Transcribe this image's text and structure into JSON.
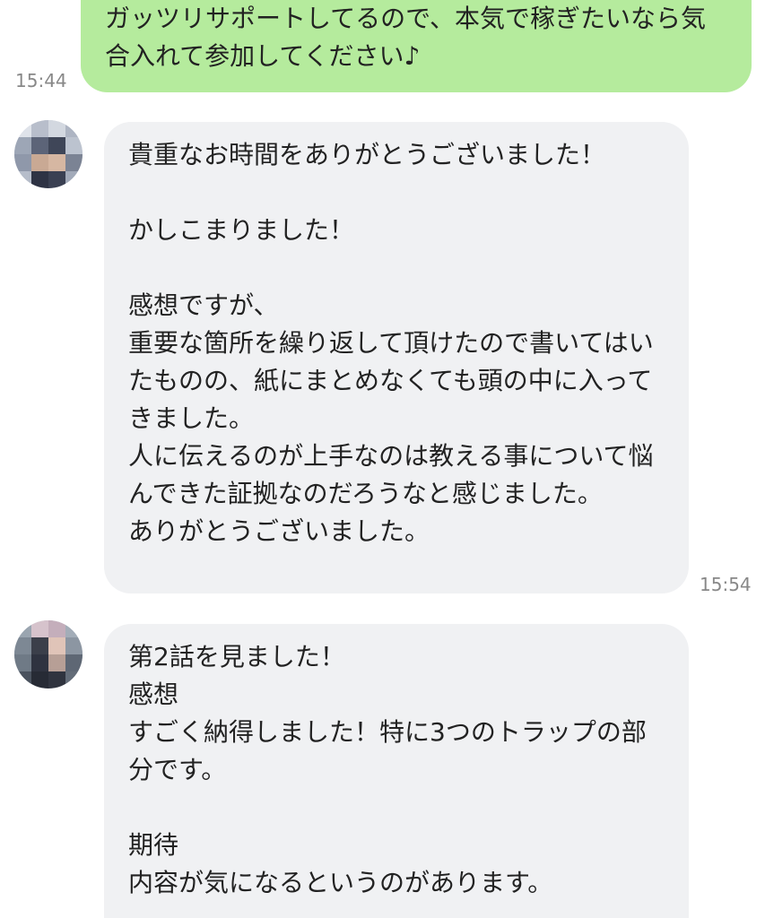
{
  "messages": [
    {
      "direction": "outgoing",
      "text": "ガッツリサポートしてるので、本気で稼ぎたいなら気合入れて参加してください♪",
      "time": "15:44"
    },
    {
      "direction": "incoming",
      "avatar": "pixelated-user-avatar",
      "text": "貴重なお時間をありがとうございました！\n\nかしこまりました！\n\n感想ですが、\n重要な箇所を繰り返して頂けたので書いてはいたものの、紙にまとめなくても頭の中に入ってきました。\n人に伝えるのが上手なのは教える事について悩んできた証拠なのだろうなと感じました。\nありがとうございました。",
      "time": "15:54"
    },
    {
      "direction": "incoming",
      "avatar": "pixelated-user-avatar",
      "text": "第2話を見ました！\n感想\nすごく納得しました！特に3つのトラップの部分です。\n\n期待\n内容が気になるというのがあります。"
    }
  ],
  "colors": {
    "outgoing_bubble": "#b5eb9d",
    "incoming_bubble": "#f0f1f3",
    "background": "#ffffff",
    "timestamp": "#888888"
  }
}
